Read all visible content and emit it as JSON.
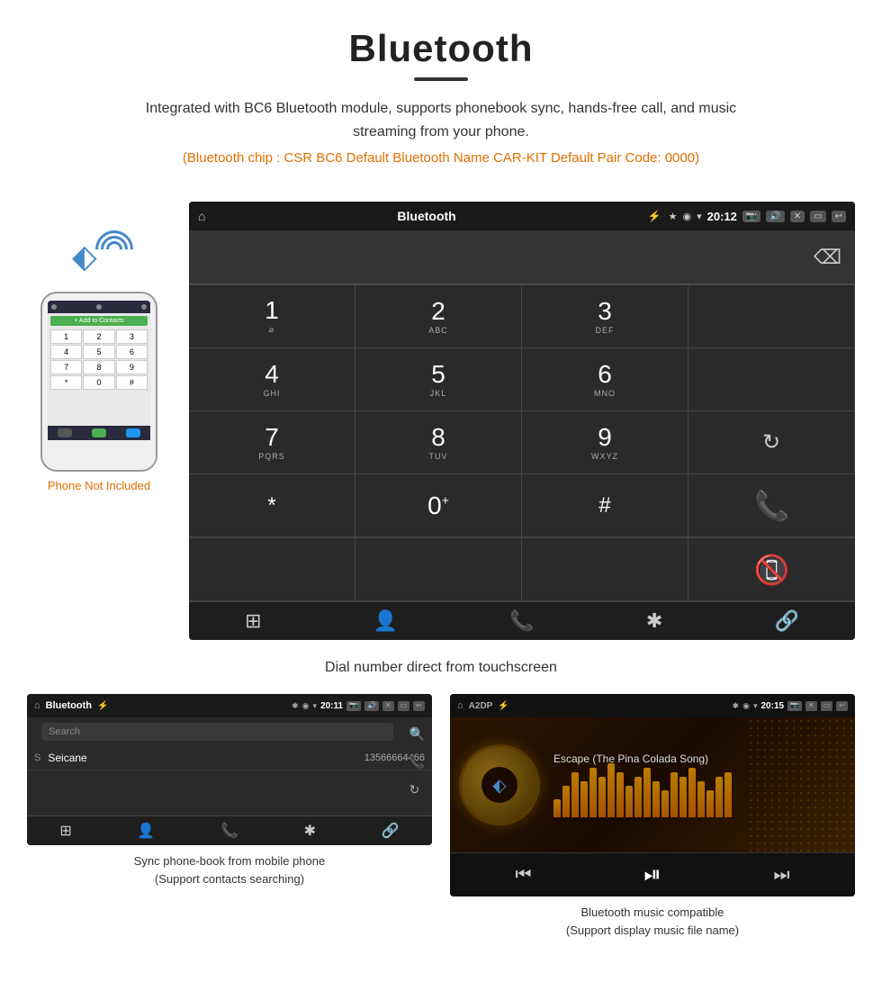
{
  "header": {
    "title": "Bluetooth",
    "description": "Integrated with BC6 Bluetooth module, supports phonebook sync, hands-free call, and music streaming from your phone.",
    "specs": "(Bluetooth chip : CSR BC6    Default Bluetooth Name CAR-KIT    Default Pair Code: 0000)"
  },
  "dialer_screen": {
    "title": "Bluetooth",
    "time": "20:12",
    "keys": [
      {
        "number": "1",
        "letters": ""
      },
      {
        "number": "2",
        "letters": "ABC"
      },
      {
        "number": "3",
        "letters": "DEF"
      },
      {
        "number": "",
        "letters": ""
      },
      {
        "number": "4",
        "letters": "GHI"
      },
      {
        "number": "5",
        "letters": "JKL"
      },
      {
        "number": "6",
        "letters": "MNO"
      },
      {
        "number": "",
        "letters": ""
      },
      {
        "number": "7",
        "letters": "PQRS"
      },
      {
        "number": "8",
        "letters": "TUV"
      },
      {
        "number": "9",
        "letters": "WXYZ"
      },
      {
        "number": "",
        "letters": ""
      },
      {
        "number": "*",
        "letters": ""
      },
      {
        "number": "0",
        "letters": "+"
      },
      {
        "number": "#",
        "letters": ""
      },
      {
        "number": "",
        "letters": ""
      }
    ]
  },
  "caption_dialer": "Dial number direct from touchscreen",
  "phonebook_screen": {
    "title": "Bluetooth",
    "time": "20:11",
    "search_placeholder": "Search",
    "contact_letter": "S",
    "contact_name": "Seicane",
    "contact_number": "13566664466"
  },
  "caption_phonebook": "Sync phone-book from mobile phone\n(Support contacts searching)",
  "music_screen": {
    "title": "A2DP",
    "time": "20:15",
    "song_name": "Escape (The Pina Colada Song)"
  },
  "caption_music": "Bluetooth music compatible\n(Support display music file name)",
  "phone_label": "Phone Not Included",
  "eq_bars": [
    20,
    35,
    50,
    40,
    55,
    45,
    60,
    50,
    35,
    45,
    55,
    40,
    30,
    50,
    45,
    55,
    40,
    30,
    45,
    50
  ]
}
